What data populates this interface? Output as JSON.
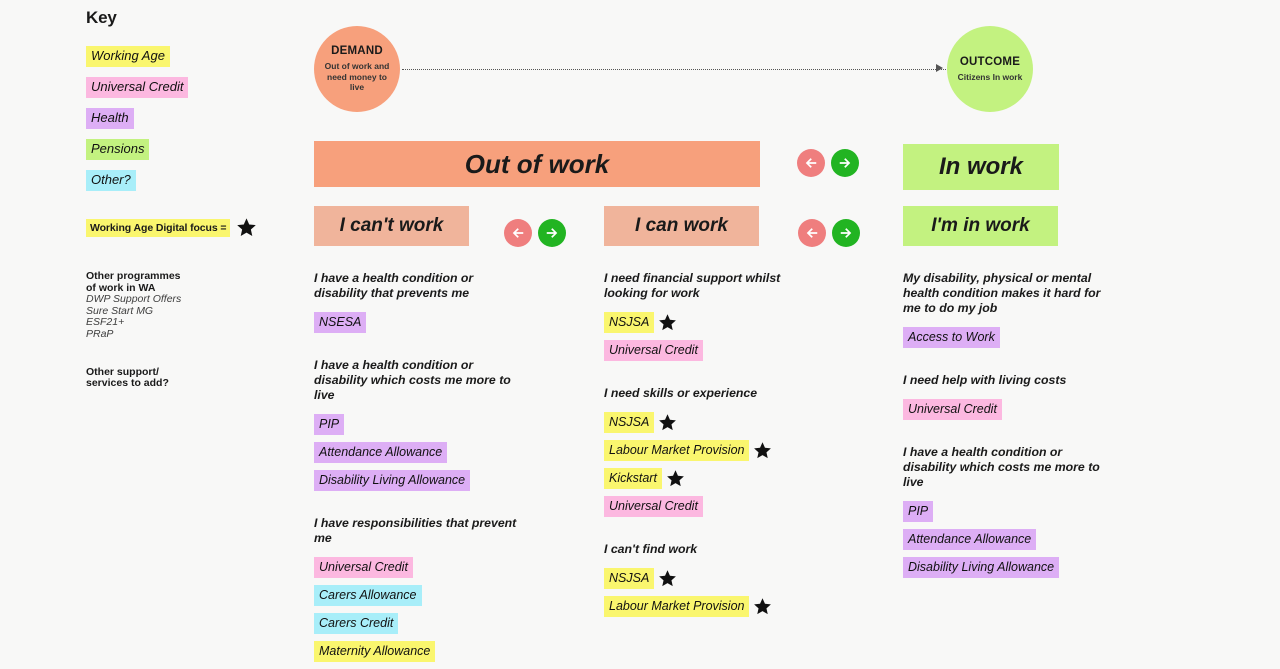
{
  "key": {
    "title": "Key",
    "items": [
      {
        "label": "Working Age",
        "color": "#faf66e",
        "swatch": "c-yellow"
      },
      {
        "label": "Universal Credit",
        "color": "#fcb8e0",
        "swatch": "c-pink"
      },
      {
        "label": "Health",
        "color": "#ddaef5",
        "swatch": "c-purple"
      },
      {
        "label": "Pensions",
        "color": "#c3f280",
        "swatch": "c-green"
      },
      {
        "label": "Other?",
        "color": "#a8eef9",
        "swatch": "c-cyan"
      }
    ],
    "focus_label": "Working Age Digital focus =",
    "other_programmes": {
      "heading_line1": "Other programmes",
      "heading_line2": "of work in WA",
      "items": [
        "DWP Support Offers",
        "Sure Start MG",
        "ESF21+",
        "PRaP"
      ]
    },
    "other_support": {
      "line1": "Other support/",
      "line2": "services to add?"
    }
  },
  "flow": {
    "demand": {
      "title": "DEMAND",
      "subtitle": "Out of work and need money to live",
      "color": "#f7a07c"
    },
    "outcome": {
      "title": "OUTCOME",
      "subtitle": "Citizens In work",
      "color": "#c3f280"
    }
  },
  "banners": {
    "out_of_work": "Out of work",
    "in_work": "In work"
  },
  "arrows": {
    "back_label": "back-arrow",
    "forward_label": "forward-arrow",
    "back_color": "#ef7e7e",
    "forward_color": "#22b422"
  },
  "columns": [
    {
      "id": "cant-work",
      "header": "I can't work",
      "header_color": "#f0b49b",
      "groups": [
        {
          "need": "I have a health condition or disability that prevents me",
          "tags": [
            {
              "label": "NSESA",
              "swatch": "c-purple",
              "star": false
            }
          ]
        },
        {
          "need": "I have a health condition or disability which costs me more to live",
          "tags": [
            {
              "label": "PIP",
              "swatch": "c-purple",
              "star": false
            },
            {
              "label": "Attendance Allowance",
              "swatch": "c-purple",
              "star": false
            },
            {
              "label": "Disability Living Allowance",
              "swatch": "c-purple",
              "star": false
            }
          ]
        },
        {
          "need": "I have responsibilities that prevent me",
          "tags": [
            {
              "label": "Universal Credit",
              "swatch": "c-pink",
              "star": false
            },
            {
              "label": "Carers Allowance",
              "swatch": "c-cyan",
              "star": false
            },
            {
              "label": "Carers Credit",
              "swatch": "c-cyan",
              "star": false
            },
            {
              "label": "Maternity Allowance",
              "swatch": "c-yellow",
              "star": false
            }
          ]
        }
      ]
    },
    {
      "id": "can-work",
      "header": "I can work",
      "header_color": "#f0b49b",
      "groups": [
        {
          "need": "I need financial support whilst looking for work",
          "tags": [
            {
              "label": "NSJSA",
              "swatch": "c-yellow",
              "star": true
            },
            {
              "label": "Universal Credit",
              "swatch": "c-pink",
              "star": false
            }
          ]
        },
        {
          "need": "I need skills or experience",
          "tags": [
            {
              "label": "NSJSA",
              "swatch": "c-yellow",
              "star": true
            },
            {
              "label": "Labour Market Provision",
              "swatch": "c-yellow",
              "star": true
            },
            {
              "label": "Kickstart",
              "swatch": "c-yellow",
              "star": true
            },
            {
              "label": "Universal Credit",
              "swatch": "c-pink",
              "star": false
            }
          ]
        },
        {
          "need": "I can't find work",
          "tags": [
            {
              "label": "NSJSA",
              "swatch": "c-yellow",
              "star": true
            },
            {
              "label": "Labour Market Provision",
              "swatch": "c-yellow",
              "star": true
            }
          ]
        }
      ]
    },
    {
      "id": "in-work",
      "header": "I'm in work",
      "header_color": "#c3f280",
      "groups": [
        {
          "need": "My disability, physical or mental health condition makes it hard for me to do my job",
          "tags": [
            {
              "label": "Access to Work",
              "swatch": "c-purple",
              "star": false
            }
          ]
        },
        {
          "need": "I need help with living costs",
          "tags": [
            {
              "label": "Universal Credit",
              "swatch": "c-pink",
              "star": false
            }
          ]
        },
        {
          "need": "I have a health condition or disability which costs me more to live",
          "tags": [
            {
              "label": "PIP",
              "swatch": "c-purple",
              "star": false
            },
            {
              "label": "Attendance Allowance",
              "swatch": "c-purple",
              "star": false
            },
            {
              "label": "Disability Living Allowance",
              "swatch": "c-purple",
              "star": false
            }
          ]
        }
      ]
    }
  ]
}
